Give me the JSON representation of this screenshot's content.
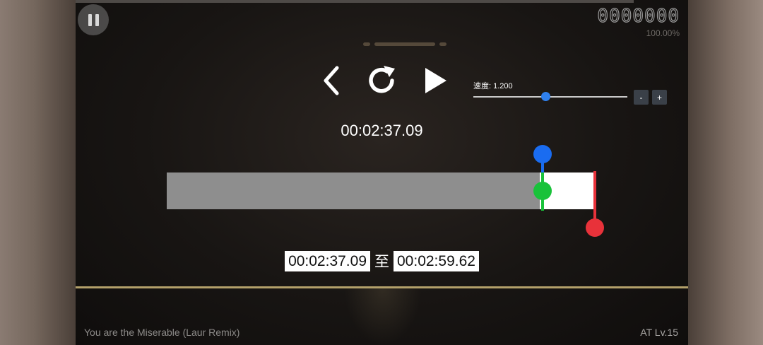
{
  "hud": {
    "score": "0000000",
    "accuracy": "100.00%",
    "pause_icon": "pause-icon"
  },
  "controls": {
    "back_icon": "chevron-left-icon",
    "restart_icon": "restart-icon",
    "play_icon": "play-icon"
  },
  "speed": {
    "label": "速度: 1.200",
    "value": 1.2,
    "slider_fraction": 0.47,
    "minus_label": "-",
    "plus_label": "+",
    "accent": "#2f80ed"
  },
  "playback": {
    "current_time": "00:02:37.09",
    "played_fraction": 0.87,
    "start_marker_fraction": 0.876,
    "end_marker_fraction": 0.998,
    "colors": {
      "start": "#1a6cf0",
      "current": "#19c23a",
      "end": "#e8323a"
    }
  },
  "range": {
    "start": "00:02:37.09",
    "separator": "至",
    "end": "00:02:59.62"
  },
  "footer": {
    "song_title": "You are the Miserable (Laur Remix)",
    "level": "AT Lv.15"
  }
}
